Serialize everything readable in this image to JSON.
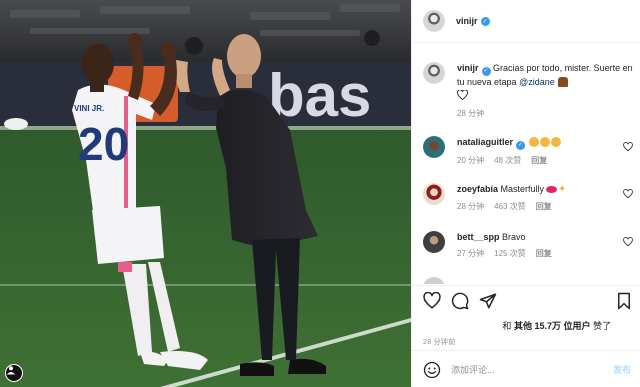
{
  "post": {
    "author": "vinijr",
    "image_alt": "Vinícius Jr. high-fiving Zinedine Zidane on the pitch",
    "jersey_text": "VINI JR.",
    "jersey_number": "20",
    "board_text": "bas"
  },
  "caption": {
    "username": "vinijr",
    "text": "Gracias por todo, mister. Suerte en tu nueva etapa ",
    "mention": "@zidane",
    "time": "28 分钟"
  },
  "comments": [
    {
      "username": "nataliaguitler",
      "verified": true,
      "text": "",
      "emoji": "clap-clap-clap",
      "time": "20 分钟",
      "likes": "48 次赞",
      "reply": "回复"
    },
    {
      "username": "zoeyfabia",
      "verified": false,
      "text": "Masterfully",
      "emoji": "lips-sparkles",
      "time": "28 分钟",
      "likes": "463 次赞",
      "reply": "回复"
    },
    {
      "username": "bett__spp",
      "verified": false,
      "text": "Bravo",
      "emoji": "",
      "time": "27 分钟",
      "likes": "125 次赞",
      "reply": "回复"
    }
  ],
  "likes_line": {
    "prefix": "和",
    "bold": "其他 15.7万 位用户",
    "suffix": "赞了"
  },
  "posted_time": "28 分钟前",
  "add_comment": {
    "placeholder": "添加评论...",
    "post_label": "发布"
  },
  "icons": [
    "heart-icon",
    "comment-icon",
    "share-icon",
    "bookmark-icon",
    "smiley-icon",
    "verified-icon"
  ],
  "colors": {
    "verified": "#3897f0",
    "link": "#00376b",
    "post_button": "#b2dffc",
    "muted": "#8e8e8e"
  }
}
